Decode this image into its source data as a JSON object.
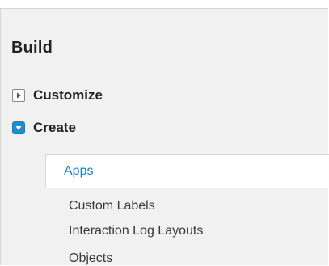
{
  "section": {
    "title": "Build"
  },
  "tree": {
    "customize": {
      "label": "Customize",
      "state": "collapsed",
      "icon": "triangle-right-icon"
    },
    "create": {
      "label": "Create",
      "state": "expanded",
      "icon": "triangle-down-icon"
    }
  },
  "create_children": {
    "selected": "Apps",
    "items": [
      "Apps",
      "Custom Labels",
      "Interaction Log Layouts",
      "Objects"
    ]
  },
  "colors": {
    "accent": "#1f8dc6",
    "link": "#1f7dc0",
    "panel_bg": "#f1f1f1"
  }
}
